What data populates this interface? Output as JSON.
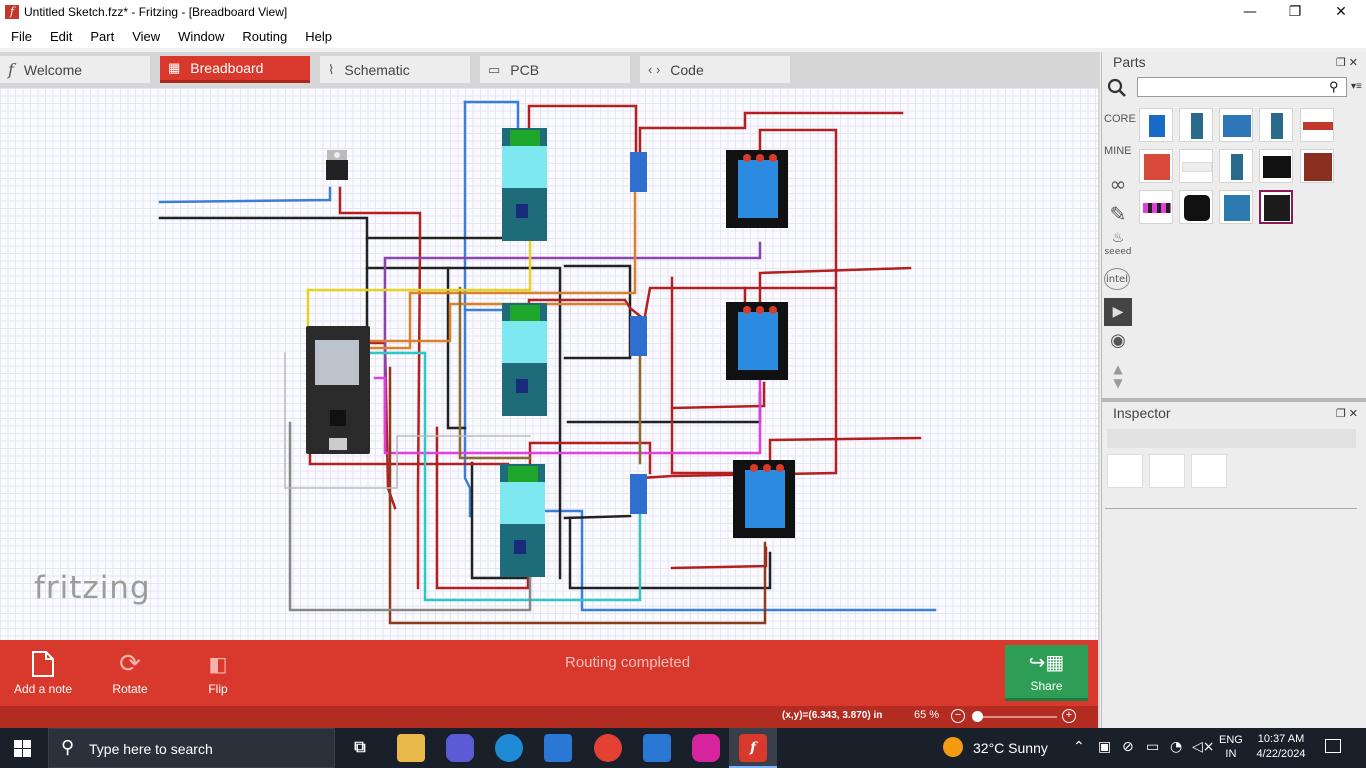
{
  "window": {
    "title": "Untitled Sketch.fzz* - Fritzing - [Breadboard View]",
    "minimize": "—",
    "restore": "❐",
    "close": "✕"
  },
  "menu": [
    "File",
    "Edit",
    "Part",
    "View",
    "Window",
    "Routing",
    "Help"
  ],
  "tabs": [
    {
      "label": "Welcome",
      "icon": "fritzing-logo-icon",
      "glyph": "f"
    },
    {
      "label": "Breadboard",
      "icon": "breadboard-icon",
      "glyph": "▦",
      "active": true
    },
    {
      "label": "Schematic",
      "icon": "resistor-icon",
      "glyph": "⌇"
    },
    {
      "label": "PCB",
      "icon": "pcb-icon",
      "glyph": "▭"
    },
    {
      "label": "Code",
      "icon": "code-icon",
      "glyph": "‹ ›"
    }
  ],
  "canvas": {
    "logo_text": "fritzing"
  },
  "toolbar": {
    "add_note": "Add a note",
    "rotate": "Rotate",
    "flip": "Flip",
    "routing_status": "Routing completed",
    "share": "Share"
  },
  "status": {
    "coords": "(x,y)=(6.343, 3.870) in",
    "zoom": "65 %",
    "zoom_minus": "−",
    "zoom_plus": "+",
    "zoom_level": 0.03
  },
  "parts_panel": {
    "title": "Parts",
    "search_placeholder": "",
    "bins": [
      "CORE",
      "MINE",
      "seeed",
      "intel"
    ]
  },
  "inspector": {
    "title": "Inspector"
  },
  "taskbar": {
    "search_placeholder": "Type here to search",
    "weather": "32°C  Sunny",
    "lang_top": "ENG",
    "lang_bottom": "IN",
    "time": "10:37 AM",
    "date": "4/22/2024"
  },
  "colors": {
    "accent": "#d9382c",
    "share": "#2e9e57",
    "canvas": "#fbfbff"
  }
}
